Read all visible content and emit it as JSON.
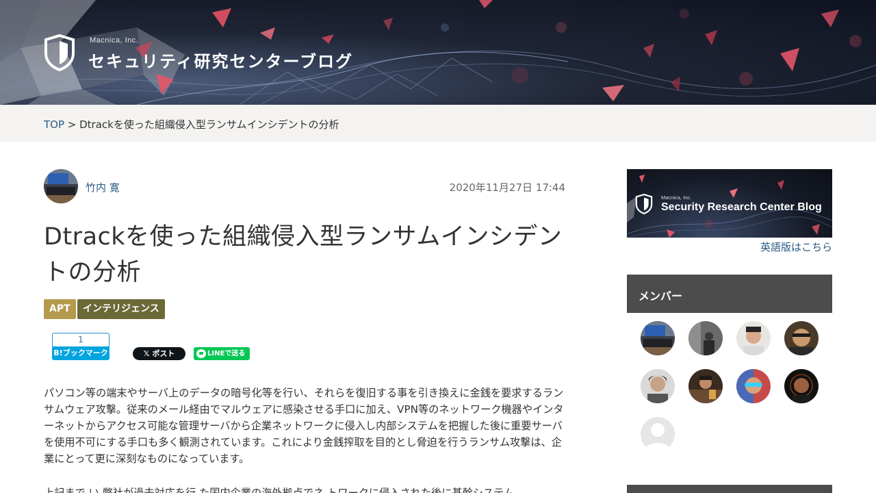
{
  "header": {
    "brand_small": "Macnica, Inc.",
    "brand_title": "セキュリティ研究センターブログ",
    "shield_icon": "shield-logo-icon"
  },
  "breadcrumb": {
    "top": "TOP",
    "separator": " > ",
    "current": "Dtrackを使った組織侵入型ランサムインシデントの分析"
  },
  "post": {
    "author": "竹内 寛",
    "date": "2020年11月27日 17:44",
    "title": "Dtrackを使った組織侵入型ランサムインシデントの分析",
    "tags": [
      "APT",
      "インテリジェンス"
    ],
    "paragraphs": [
      "パソコン等の端末やサーバ上のデータの暗号化等を行い、それらを復旧する事を引き換えに金銭を要求するランサムウェア攻撃。従来のメール経由でマルウェアに感染させる手口に加え、VPN等のネットワーク機器やインターネットからアクセス可能な管理サーバから企業ネットワークに侵入し内部システムを把握した後に重要サーバを使用不可にする手口も多く観測されています。これにより金銭搾取を目的とし脅迫を行うランサム攻撃は、企業にとって更に深刻なものになっています。",
      "上記まで い 弊社が過去対応を行 た国内企業の海外拠点でネ トワークに侵入された後に基幹システム"
    ]
  },
  "share": {
    "hatena_count": "1",
    "hatena_label": "B!ブックマーク",
    "x_label": "𝕏 ポスト",
    "line_label": "LINEで送る"
  },
  "sidebar": {
    "banner_small": "Macnica, Inc.",
    "banner_title": "Security Research Center Blog",
    "english_link": "英語版はこちら",
    "members_heading": "メンバー"
  },
  "colors": {
    "link": "#2c5b86",
    "tag_apt": "#b5994c",
    "tag_intel": "#6b6a37",
    "sidebar_head": "#4c4c4c"
  }
}
